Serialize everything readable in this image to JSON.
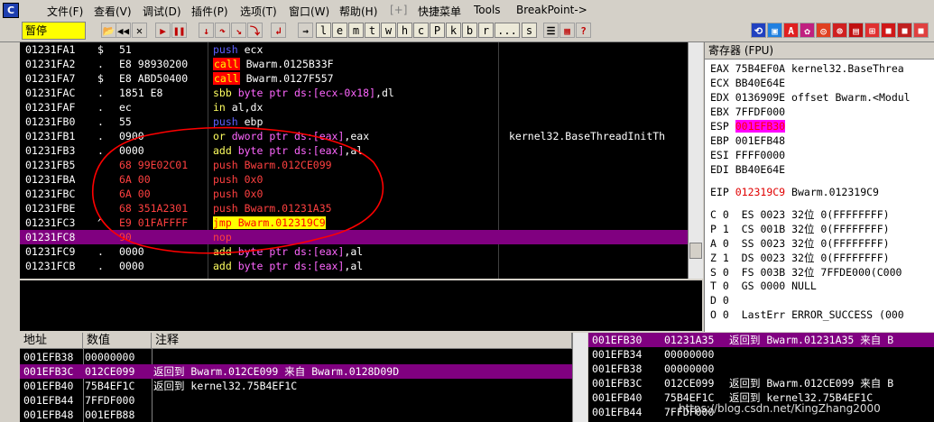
{
  "menubar": {
    "items": [
      "文件(F)",
      "查看(V)",
      "调试(D)",
      "插件(P)",
      "选项(T)",
      "窗口(W)",
      "帮助(H)",
      "[+]",
      "快捷菜单",
      "Tools",
      "BreakPoint->"
    ]
  },
  "toolbar": {
    "status": "暂停",
    "letters": [
      "l",
      "e",
      "m",
      "t",
      "w",
      "h",
      "c",
      "P",
      "k",
      "b",
      "r",
      "...",
      "s"
    ]
  },
  "disasm": {
    "rows": [
      {
        "addr": "01231FA1",
        "mark": "$",
        "hex": "51",
        "asm": [
          [
            "push",
            "k-push"
          ],
          [
            " ecx",
            ""
          ]
        ],
        "cmt": ""
      },
      {
        "addr": "01231FA2",
        "mark": ".",
        "hex": "E8 98930200",
        "asm": [
          [
            "call",
            "k-call"
          ],
          [
            " Bwarm.0125B33F",
            ""
          ]
        ],
        "cmt": ""
      },
      {
        "addr": "01231FA7",
        "mark": "$",
        "hex": "E8 ABD50400",
        "asm": [
          [
            "call",
            "k-call"
          ],
          [
            " Bwarm.0127F557",
            ""
          ]
        ],
        "cmt": ""
      },
      {
        "addr": "01231FAC",
        "mark": ".",
        "hex": "1851 E8",
        "asm": [
          [
            "sbb",
            "k-sbb"
          ],
          [
            " byte ptr ds:[ecx-0x18]",
            "k-mem"
          ],
          [
            ",dl",
            ""
          ]
        ],
        "cmt": ""
      },
      {
        "addr": "01231FAF",
        "mark": ".",
        "hex": "ec",
        "asm": [
          [
            "in",
            "k-in"
          ],
          [
            " al,dx",
            ""
          ]
        ],
        "cmt": ""
      },
      {
        "addr": "01231FB0",
        "mark": ".",
        "hex": "55",
        "asm": [
          [
            "push",
            "k-push"
          ],
          [
            " ebp",
            ""
          ]
        ],
        "cmt": ""
      },
      {
        "addr": "01231FB1",
        "mark": ".",
        "hex": "0900",
        "asm": [
          [
            "or",
            "k-or"
          ],
          [
            " dword ptr ds:[eax]",
            "k-mem"
          ],
          [
            ",eax",
            ""
          ]
        ],
        "cmt": "kernel32.BaseThreadInitTh"
      },
      {
        "addr": "01231FB3",
        "mark": ".",
        "hex": "0000",
        "asm": [
          [
            "add",
            "k-add"
          ],
          [
            " byte ptr ds:[eax]",
            "k-mem"
          ],
          [
            ",al",
            ""
          ]
        ],
        "cmt": ""
      },
      {
        "addr": "01231FB5",
        "mark": "",
        "hex": "68 99E02C01",
        "hexc": "r-hex",
        "asm": [
          [
            "push Bwarm.012CE099",
            "r-hex"
          ]
        ],
        "cmt": ""
      },
      {
        "addr": "01231FBA",
        "mark": "",
        "hex": "6A 00",
        "hexc": "r-hex",
        "asm": [
          [
            "push 0x0",
            "r-hex"
          ]
        ],
        "cmt": ""
      },
      {
        "addr": "01231FBC",
        "mark": "",
        "hex": "6A 00",
        "hexc": "r-hex",
        "asm": [
          [
            "push 0x0",
            "r-hex"
          ]
        ],
        "cmt": ""
      },
      {
        "addr": "01231FBE",
        "mark": "",
        "hex": "68 351A2301",
        "hexc": "r-hex",
        "asm": [
          [
            "push Bwarm.01231A35",
            "r-hex"
          ]
        ],
        "cmt": ""
      },
      {
        "addr": "01231FC3",
        "mark": "^",
        "hex": "E9 01FAFFFF",
        "hexc": "r-hex",
        "asm": [
          [
            "jmp Bwarm.012319C9",
            "k-jmp"
          ]
        ],
        "cmt": ""
      },
      {
        "addr": "01231FC8",
        "mark": "",
        "hex": "90",
        "hexc": "r-hex",
        "asm": [
          [
            "nop",
            "k-nop"
          ]
        ],
        "cmt": "",
        "sel": true
      },
      {
        "addr": "01231FC9",
        "mark": ".",
        "hex": "0000",
        "asm": [
          [
            "add",
            "k-add"
          ],
          [
            " byte ptr ds:[eax]",
            "k-mem"
          ],
          [
            ",al",
            ""
          ]
        ],
        "cmt": ""
      },
      {
        "addr": "01231FCB",
        "mark": ".",
        "hex": "0000",
        "asm": [
          [
            "add",
            "k-add"
          ],
          [
            " byte ptr ds:[eax]",
            "k-mem"
          ],
          [
            ",al",
            ""
          ]
        ],
        "cmt": ""
      }
    ]
  },
  "registers": {
    "title": "寄存器 (FPU)",
    "general": [
      {
        "name": "EAX",
        "value": "75B4EF0A",
        "note": "kernel32.BaseThrea"
      },
      {
        "name": "ECX",
        "value": "BB40E64E",
        "note": ""
      },
      {
        "name": "EDX",
        "value": "0136909E",
        "note": "offset Bwarm.<Modul"
      },
      {
        "name": "EBX",
        "value": "7FFDF000",
        "note": ""
      },
      {
        "name": "ESP",
        "value": "001EFB30",
        "note": "",
        "hl": true
      },
      {
        "name": "EBP",
        "value": "001EFB48",
        "note": ""
      },
      {
        "name": "ESI",
        "value": "FFFF0000",
        "note": ""
      },
      {
        "name": "EDI",
        "value": "BB40E64E",
        "note": ""
      }
    ],
    "eip": {
      "name": "EIP",
      "value": "012319C9",
      "note": "Bwarm.012319C9"
    },
    "flags": [
      {
        "flag": "C",
        "bit": "0",
        "seg": "ES",
        "sel": "0023",
        "bits": "32位",
        "base": "0(FFFFFFFF)"
      },
      {
        "flag": "P",
        "bit": "1",
        "seg": "CS",
        "sel": "001B",
        "bits": "32位",
        "base": "0(FFFFFFFF)"
      },
      {
        "flag": "A",
        "bit": "0",
        "seg": "SS",
        "sel": "0023",
        "bits": "32位",
        "base": "0(FFFFFFFF)"
      },
      {
        "flag": "Z",
        "bit": "1",
        "seg": "DS",
        "sel": "0023",
        "bits": "32位",
        "base": "0(FFFFFFFF)"
      },
      {
        "flag": "S",
        "bit": "0",
        "seg": "FS",
        "sel": "003B",
        "bits": "32位",
        "base": "7FFDE000(C000"
      },
      {
        "flag": "T",
        "bit": "0",
        "seg": "GS",
        "sel": "0000",
        "bits": "NULL",
        "base": ""
      },
      {
        "flag": "D",
        "bit": "0",
        "seg": "",
        "sel": "",
        "bits": "",
        "base": ""
      },
      {
        "flag": "O",
        "bit": "0",
        "seg": "LastErr",
        "sel": "ERROR_SUCCESS",
        "bits": "(000",
        "base": ""
      }
    ]
  },
  "dump": {
    "headers": [
      "地址",
      "数值",
      "注释"
    ],
    "rows": [
      {
        "addr": "001EFB38",
        "val": "00000000",
        "cmt": ""
      },
      {
        "addr": "001EFB3C",
        "val": "012CE099",
        "cmt": "返回到 Bwarm.012CE099 来自 Bwarm.0128D09D",
        "sel": true
      },
      {
        "addr": "001EFB40",
        "val": "75B4EF1C",
        "cmt": "返回到 kernel32.75B4EF1C"
      },
      {
        "addr": "001EFB44",
        "val": "7FFDF000",
        "cmt": ""
      },
      {
        "addr": "001EFB48",
        "val": "001EFB88",
        "cmt": ""
      }
    ]
  },
  "stack": {
    "rows": [
      {
        "addr": "001EFB30",
        "val": "01231A35",
        "cmt": "返回到 Bwarm.01231A35 来自 B",
        "sel": true
      },
      {
        "addr": "001EFB34",
        "val": "00000000",
        "cmt": ""
      },
      {
        "addr": "001EFB38",
        "val": "00000000",
        "cmt": ""
      },
      {
        "addr": "001EFB3C",
        "val": "012CE099",
        "cmt": "返回到 Bwarm.012CE099 来自 B"
      },
      {
        "addr": "001EFB40",
        "val": "75B4EF1C",
        "cmt": "返回到 kernel32.75B4EF1C"
      },
      {
        "addr": "001EFB44",
        "val": "7FFDF000",
        "cmt": ""
      }
    ]
  },
  "watermark": "https://blog.csdn.net/KingZhang2000",
  "colors": {
    "selection": "#800080",
    "highlight_yellow": "#ffff00",
    "annotation_red": "#ff0000"
  }
}
